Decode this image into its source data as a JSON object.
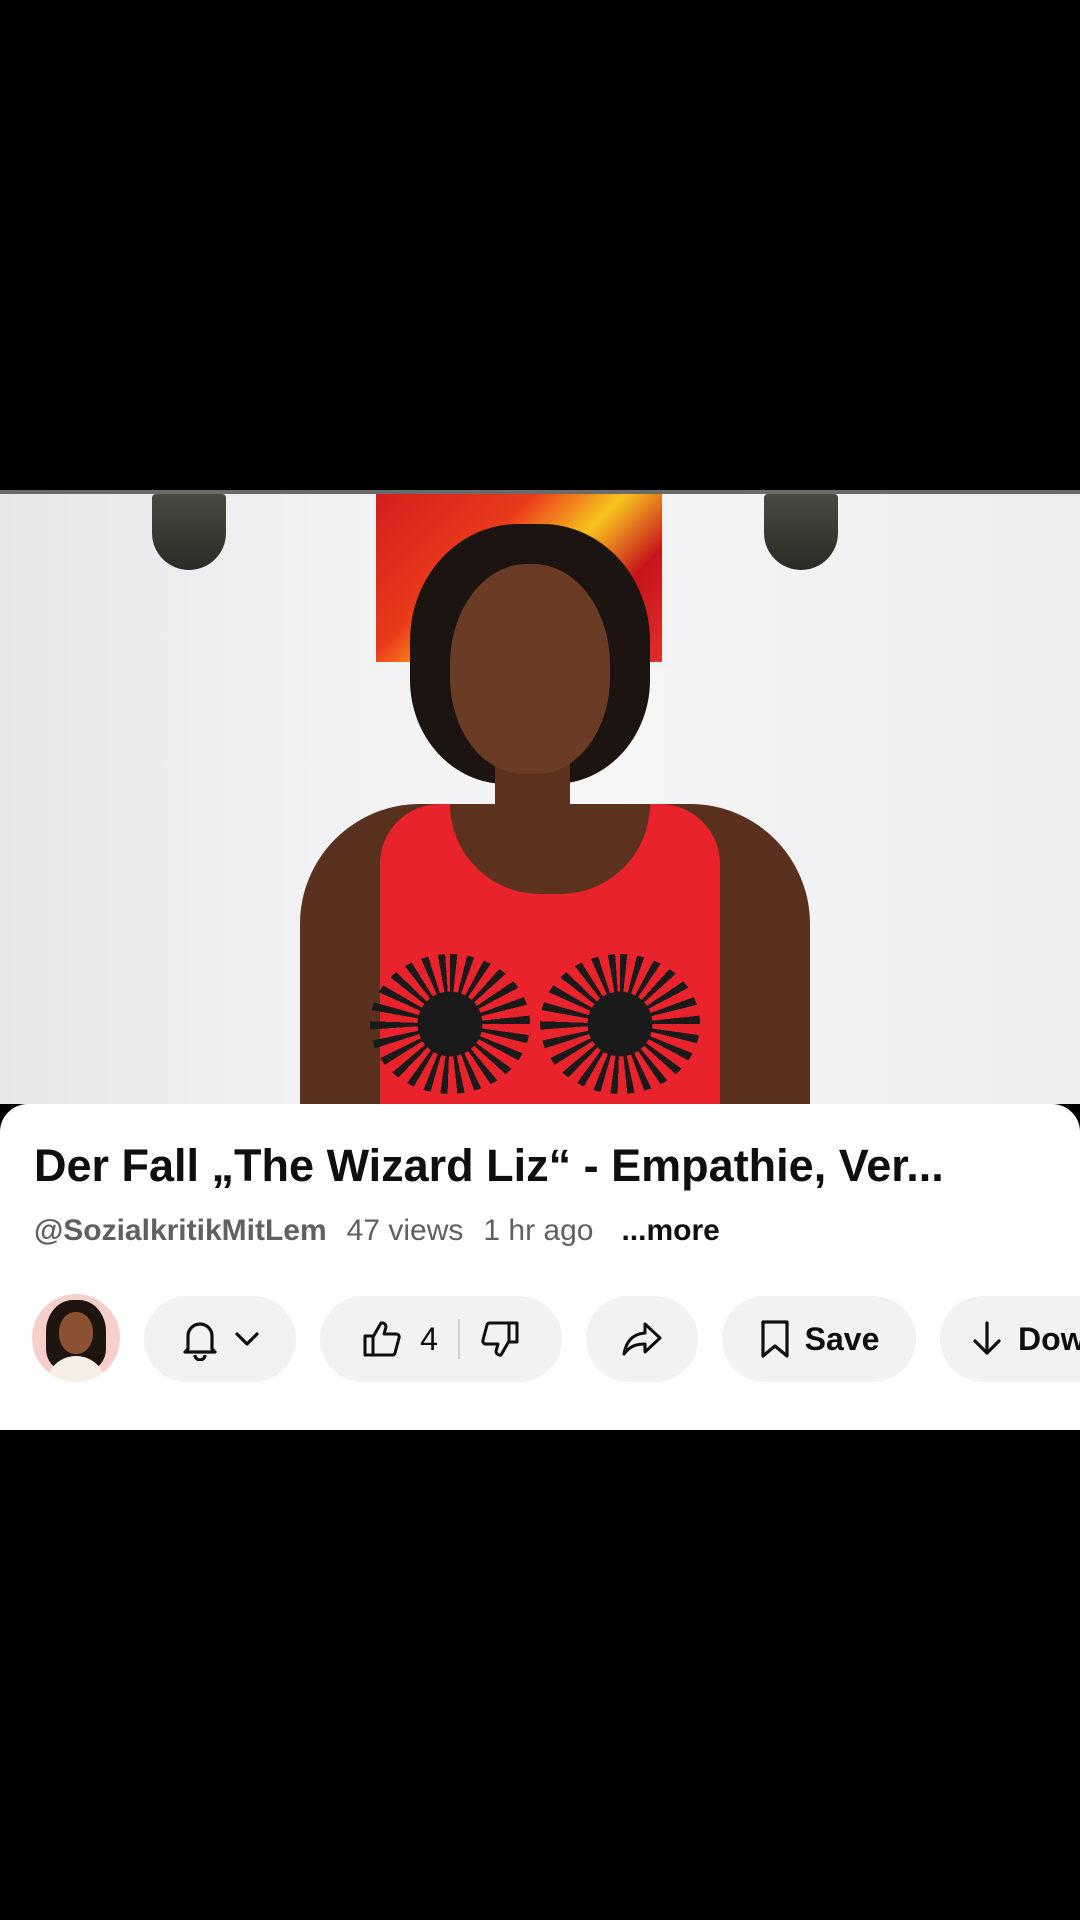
{
  "video": {
    "title": "Der Fall „The Wizard Liz“ - Empathie, Ver..."
  },
  "meta": {
    "channel": "@SozialkritikMitLem",
    "views": "47 views",
    "age": "1 hr ago",
    "more": "...more"
  },
  "actions": {
    "like_count": "4",
    "save_label": "Save",
    "download_label": "Dow"
  },
  "icons": {
    "bell": "bell-icon",
    "chevron": "chevron-down-icon",
    "like": "thumb-up-icon",
    "dislike": "thumb-down-icon",
    "share": "share-icon",
    "save": "bookmark-icon",
    "download": "download-icon"
  },
  "colors": {
    "sheet_bg": "#ffffff",
    "pill_bg": "#f2f2f2",
    "text_primary": "#0f0f0f",
    "text_secondary": "#606060"
  }
}
